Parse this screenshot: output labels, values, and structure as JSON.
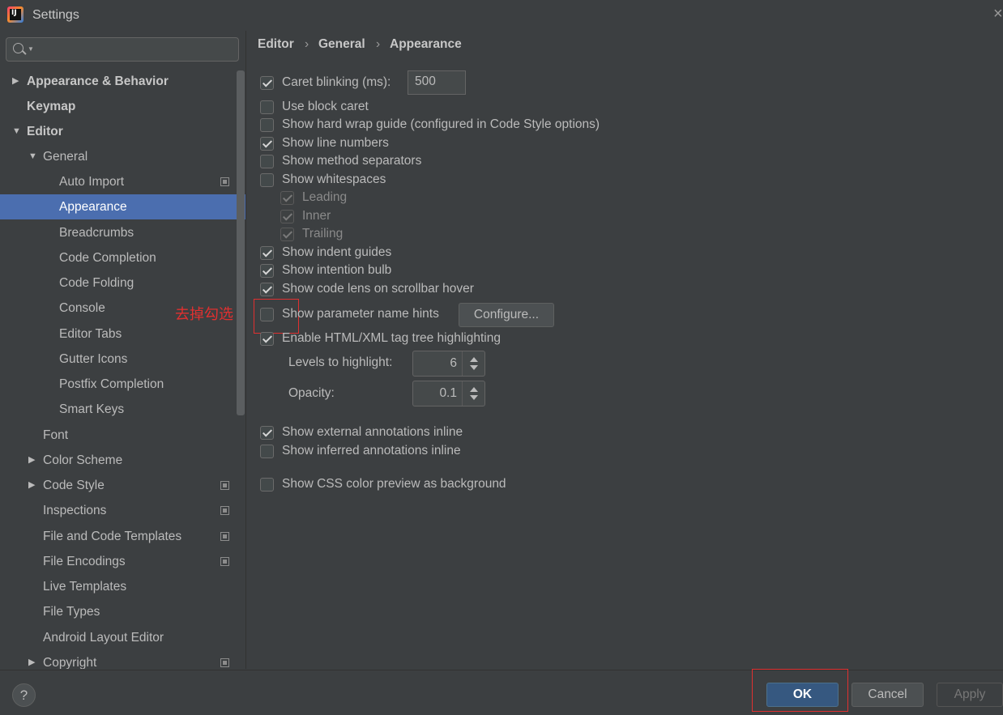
{
  "window": {
    "title": "Settings",
    "icon_text": "IJ"
  },
  "search": {
    "placeholder": ""
  },
  "tree": [
    {
      "label": "Appearance & Behavior",
      "level": 0,
      "arrow": "right",
      "bold": true
    },
    {
      "label": "Keymap",
      "level": 0,
      "arrow": "",
      "bold": true
    },
    {
      "label": "Editor",
      "level": 0,
      "arrow": "down",
      "bold": true
    },
    {
      "label": "General",
      "level": 1,
      "arrow": "down"
    },
    {
      "label": "Auto Import",
      "level": 2,
      "project_icon": true
    },
    {
      "label": "Appearance",
      "level": 2,
      "selected": true
    },
    {
      "label": "Breadcrumbs",
      "level": 2
    },
    {
      "label": "Code Completion",
      "level": 2
    },
    {
      "label": "Code Folding",
      "level": 2
    },
    {
      "label": "Console",
      "level": 2
    },
    {
      "label": "Editor Tabs",
      "level": 2
    },
    {
      "label": "Gutter Icons",
      "level": 2
    },
    {
      "label": "Postfix Completion",
      "level": 2
    },
    {
      "label": "Smart Keys",
      "level": 2
    },
    {
      "label": "Font",
      "level": 1
    },
    {
      "label": "Color Scheme",
      "level": 1,
      "arrow": "right"
    },
    {
      "label": "Code Style",
      "level": 1,
      "arrow": "right",
      "project_icon": true
    },
    {
      "label": "Inspections",
      "level": 1,
      "project_icon": true
    },
    {
      "label": "File and Code Templates",
      "level": 1,
      "project_icon": true
    },
    {
      "label": "File Encodings",
      "level": 1,
      "project_icon": true
    },
    {
      "label": "Live Templates",
      "level": 1
    },
    {
      "label": "File Types",
      "level": 1
    },
    {
      "label": "Android Layout Editor",
      "level": 1
    },
    {
      "label": "Copyright",
      "level": 1,
      "arrow": "right",
      "project_icon": true
    }
  ],
  "breadcrumb": {
    "items": [
      "Editor",
      "General",
      "Appearance"
    ],
    "separator": "›"
  },
  "options": {
    "caret_blinking": {
      "label": "Caret blinking (ms):",
      "checked": true,
      "value": "500"
    },
    "block_caret": {
      "label": "Use block caret",
      "checked": false
    },
    "hard_wrap": {
      "label": "Show hard wrap guide (configured in Code Style options)",
      "checked": false
    },
    "line_numbers": {
      "label": "Show line numbers",
      "checked": true
    },
    "method_separators": {
      "label": "Show method separators",
      "checked": false
    },
    "whitespaces": {
      "label": "Show whitespaces",
      "checked": false
    },
    "leading": {
      "label": "Leading",
      "checked": true
    },
    "inner": {
      "label": "Inner",
      "checked": true
    },
    "trailing": {
      "label": "Trailing",
      "checked": true
    },
    "indent_guides": {
      "label": "Show indent guides",
      "checked": true
    },
    "intention_bulb": {
      "label": "Show intention bulb",
      "checked": true
    },
    "code_lens": {
      "label": "Show code lens on scrollbar hover",
      "checked": true
    },
    "param_hints": {
      "label": "Show parameter name hints",
      "checked": false,
      "button": "Configure..."
    },
    "tag_tree": {
      "label": "Enable HTML/XML tag tree highlighting",
      "checked": true
    },
    "levels": {
      "label": "Levels to highlight:",
      "value": "6"
    },
    "opacity": {
      "label": "Opacity:",
      "value": "0.1"
    },
    "external_annotations": {
      "label": "Show external annotations inline",
      "checked": true
    },
    "inferred_annotations": {
      "label": "Show inferred annotations inline",
      "checked": false
    },
    "css_preview": {
      "label": "Show CSS color preview as background",
      "checked": false
    }
  },
  "annotation": {
    "text": "去掉勾选",
    "color": "#e03030"
  },
  "footer": {
    "help": "?",
    "ok": "OK",
    "cancel": "Cancel",
    "apply": "Apply"
  },
  "colors": {
    "selection": "#4b6eaf",
    "background": "#3c3f41",
    "ok_button": "#365880"
  }
}
